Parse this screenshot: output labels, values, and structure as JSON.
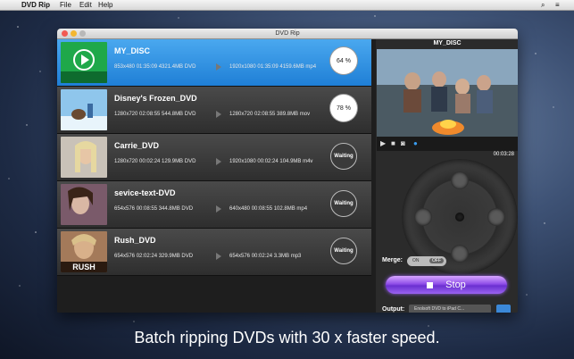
{
  "menubar": {
    "apple": "",
    "app": "DVD Rip",
    "file": "File",
    "edit": "Edit",
    "help": "Help"
  },
  "window": {
    "title": "DVD Rip"
  },
  "items": [
    {
      "title": "MY_DISC",
      "src": "853x480  01:35:09  4321.4MB  DVD",
      "dst": "1920x1080  01:35:09  4159.6MB  mp4",
      "status": "64 %",
      "selected": true
    },
    {
      "title": "Disney's Frozen_DVD",
      "src": "1280x720  02:08:55  544.8MB  DVD",
      "dst": "1280x720  02:08:55  389.8MB  mov",
      "status": "78 %"
    },
    {
      "title": "Carrie_DVD",
      "src": "1280x720  00:02:24  129.9MB  DVD",
      "dst": "1920x1080  00:02:24  104.9MB  m4v",
      "status": "Waiting"
    },
    {
      "title": "sevice-text-DVD",
      "src": "654x576  00:08:55  344.8MB  DVD",
      "dst": "640x480  00:08:55  102.8MB  mp4",
      "status": "Waiting"
    },
    {
      "title": "Rush_DVD",
      "src": "654x576  02:02:24  329.9MB  DVD",
      "dst": "654x576  00:02:24  3.3MB  mp3",
      "status": "Waiting"
    }
  ],
  "player": {
    "title": "MY_DISC",
    "time": "00:03:28"
  },
  "merge": {
    "label": "Merge:",
    "on": "ON",
    "off": "OFF"
  },
  "stop_label": "Stop",
  "output": {
    "label": "Output:",
    "value": "Enolsoft DVD to iPad C..."
  },
  "caption": "Batch ripping DVDs with 30 x faster speed.",
  "icons": {
    "play": "play-icon",
    "stop": "stop-icon",
    "camera": "camera-icon",
    "globe": "globe-icon"
  },
  "colors": {
    "accent": "#2f8ee3",
    "stop_button": "#8f4de8"
  }
}
